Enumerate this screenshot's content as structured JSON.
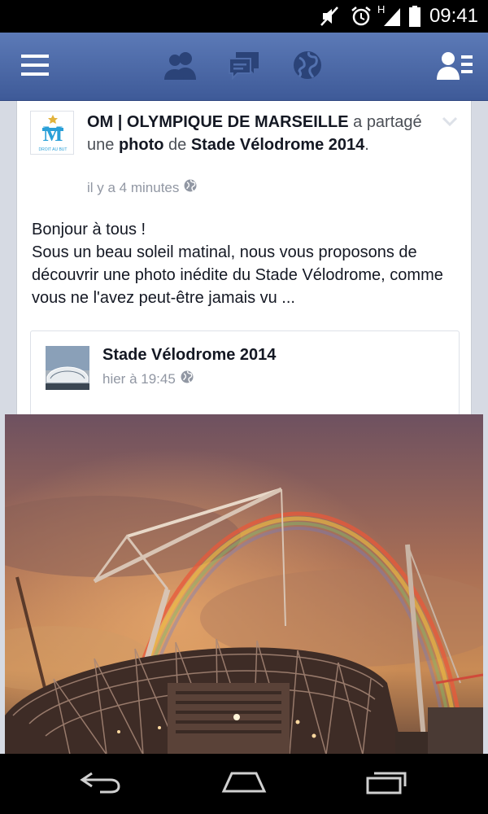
{
  "status_bar": {
    "time": "09:41",
    "network_type": "H"
  },
  "nav": {
    "icons": [
      "menu-icon",
      "friend-requests-icon",
      "messages-icon",
      "notifications-globe-icon",
      "friends-list-icon"
    ]
  },
  "post": {
    "author": "OM | OLYMPIQUE DE MARSEILLE",
    "action_a": "a",
    "action_shared": "partagé une",
    "object": "photo",
    "preposition": "de",
    "target": "Stade Vélodrome 2014",
    "period": ".",
    "timestamp": "il y a 4 minutes",
    "avatar_caption": "DROIT AU BUT",
    "text": "Bonjour à tous !\nSous un beau soleil matinal, nous vous proposons de découvrir une photo inédite du Stade Vélodrome, comme vous ne l'avez peut-être jamais vu ..."
  },
  "shared": {
    "title": "Stade Vélodrome 2014",
    "timestamp": "hier à 19:45"
  },
  "colors": {
    "fb_blue": "#3e5a98",
    "om_blue": "#2aa0d8",
    "meta_gray": "#9197a3"
  }
}
